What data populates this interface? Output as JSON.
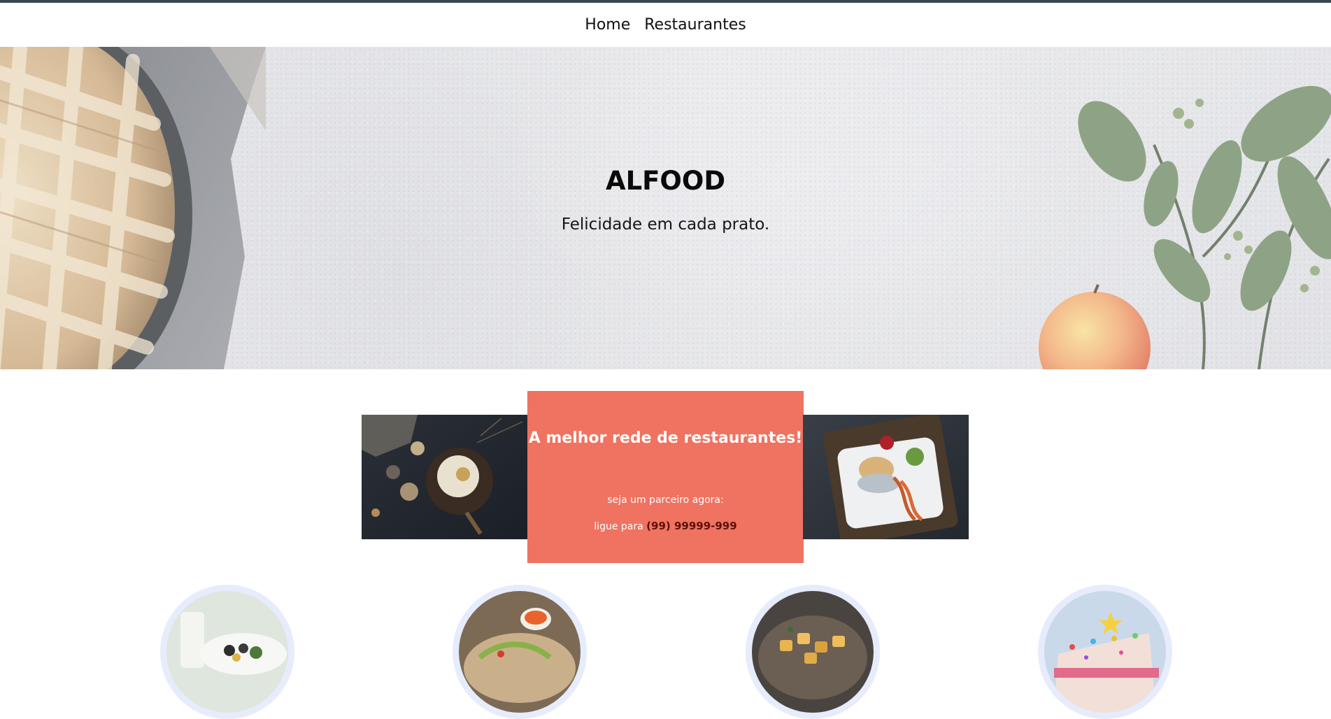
{
  "nav": {
    "items": [
      {
        "label": "Home"
      },
      {
        "label": "Restaurantes"
      }
    ]
  },
  "hero": {
    "title": "ALFOOD",
    "subtitle": "Felicidade em cada prato."
  },
  "promo": {
    "title": "A melhor rede de restaurantes!",
    "line1": "seja um parceiro agora:",
    "line2_prefix": "ligue para",
    "phone": "(99) 99999-999"
  },
  "categories": [
    {
      "icon": "salad-dish-image"
    },
    {
      "icon": "taco-dish-image"
    },
    {
      "icon": "potato-dish-image"
    },
    {
      "icon": "cake-dessert-image"
    }
  ],
  "colors": {
    "topline": "#37474f",
    "promo_bg": "#f07260",
    "promo_phone": "#5a1208",
    "circle_ring": "#e6ecfb"
  }
}
